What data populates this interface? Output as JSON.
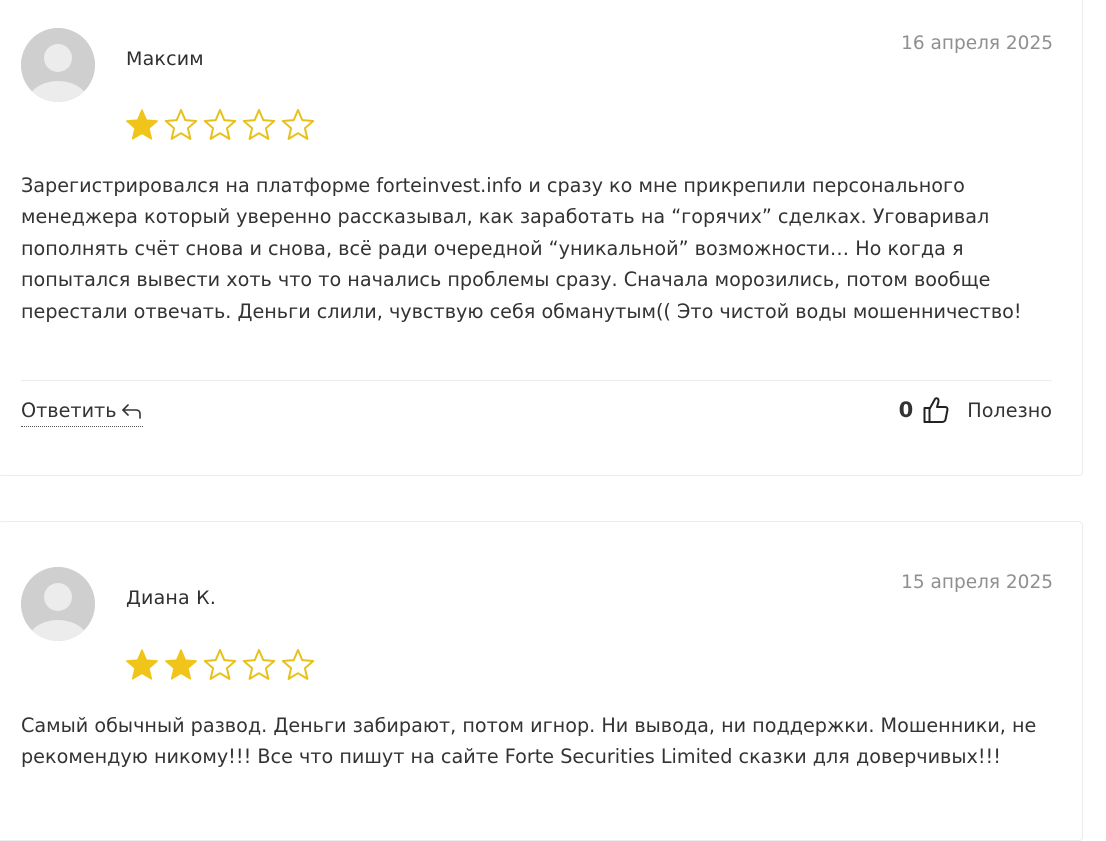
{
  "reviews": [
    {
      "author": "Максим",
      "date": "16 апреля 2025",
      "rating": 1,
      "max_rating": 5,
      "text": "Зарегистрировался на платформе forteinvest.info и сразу ко мне прикрепили персонального менеджера который уверенно рассказывал, как заработать на “горячих” сделках. Уговаривал пополнять счёт снова и снова, всё ради очередной “уникальной” возможности… Но когда я попытался вывести хоть что то начались проблемы сразу. Сначала морозились, потом вообще перестали отвечать. Деньги слили, чувствую себя обманутым(( Это чистой воды мошенничество!",
      "reply_label": "Ответить",
      "helpful_count": "0",
      "helpful_label": "Полезно"
    },
    {
      "author": "Диана К.",
      "date": "15 апреля 2025",
      "rating": 2,
      "max_rating": 5,
      "text": "Самый обычный развод. Деньги забирают, потом игнор. Ни вывода, ни поддержки. Мошенники, не рекомендую никому!!! Все что пишут на сайте Forte Securities Limited сказки для доверчивых!!!"
    }
  ],
  "colors": {
    "star_fill": "#f0c419",
    "star_outline": "#e8c01a",
    "date": "#8f8f8f",
    "border": "#ececec",
    "avatar_bg": "#d4d4d4"
  },
  "icons": {
    "avatar": "user-silhouette-icon",
    "star": "star-icon",
    "reply": "reply-arrow-icon",
    "helpful": "thumbs-up-icon"
  }
}
